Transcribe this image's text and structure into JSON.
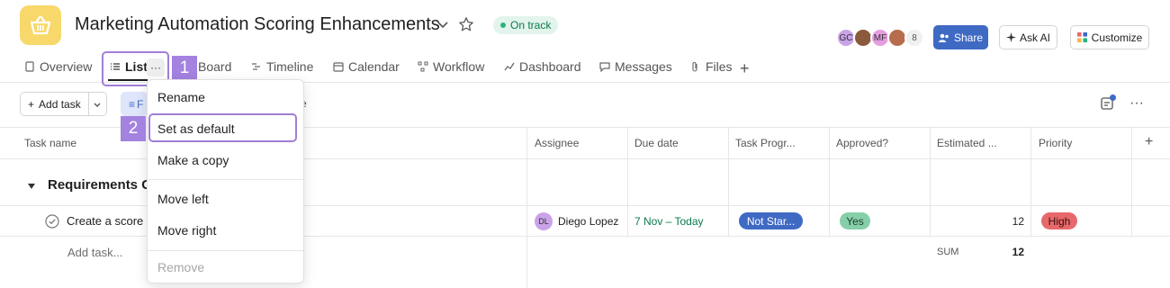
{
  "header": {
    "project_title": "Marketing Automation Scoring Enhancements",
    "status": "On track",
    "avatars": [
      "GC",
      "",
      "MF",
      ""
    ],
    "member_count": "8",
    "share_label": "Share",
    "ask_ai_label": "Ask AI",
    "customize_label": "Customize"
  },
  "tabs": [
    "Overview",
    "List",
    "Board",
    "Timeline",
    "Calendar",
    "Workflow",
    "Dashboard",
    "Messages",
    "Files"
  ],
  "list_more_label": "···",
  "steps": [
    "1",
    "2"
  ],
  "toolbar": {
    "add_task_label": "Add task",
    "filter_label": "F",
    "partial_text": "e"
  },
  "columns": [
    "Task name",
    "Assignee",
    "Due date",
    "Task Progr...",
    "Approved?",
    "Estimated ...",
    "Priority"
  ],
  "section": {
    "title": "Requirements G"
  },
  "task": {
    "name": "Create a score",
    "assignee_initials": "DL",
    "assignee_name": "Diego Lopez",
    "due_date": "7 Nov – Today",
    "progress": "Not Star...",
    "approved": "Yes",
    "estimated": "12",
    "priority": "High"
  },
  "add_task_row": "Add task...",
  "summary": {
    "label": "SUM",
    "value": "12"
  },
  "menu": {
    "rename": "Rename",
    "set_default": "Set as default",
    "copy": "Make a copy",
    "move_left": "Move left",
    "move_right": "Move right",
    "remove": "Remove"
  },
  "colors": {
    "accent": "#3f6ac4",
    "highlight": "#a07ed8",
    "status_green": "#0b7a4b",
    "priority_high": "#e8696b"
  }
}
